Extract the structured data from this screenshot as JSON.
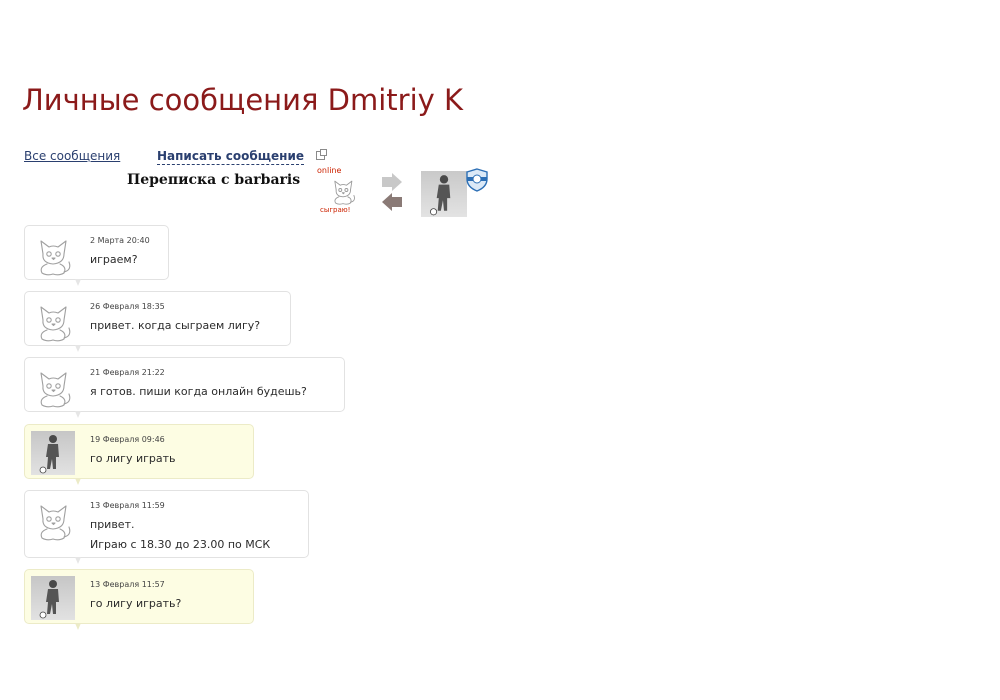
{
  "page": {
    "title": "Личные сообщения Dmitriy K"
  },
  "nav": {
    "all_messages": "Все сообщения",
    "write_message": "Написать сообщение"
  },
  "conversation": {
    "label": "Переписка с barbaris",
    "partner_status": "online",
    "partner_badge": "сыграю!"
  },
  "icons": {
    "partner_avatar": "cat-icon",
    "swap": "swap-arrows-icon",
    "my_avatar": "footballer-icon",
    "badge": "shield-icon"
  },
  "colors": {
    "title": "#8b1a1a",
    "link": "#2a3f6f",
    "my_message_bg": "#fdfde3"
  },
  "messages": [
    {
      "author": "barbaris",
      "time": "2 Марта 20:40",
      "lines": [
        "играем?"
      ]
    },
    {
      "author": "barbaris",
      "time": "26 Февраля 18:35",
      "lines": [
        "привет. когда сыграем лигу?"
      ]
    },
    {
      "author": "barbaris",
      "time": "21 Февраля 21:22",
      "lines": [
        "я готов. пиши когда онлайн будешь?"
      ]
    },
    {
      "author": "me",
      "time": "19 Февраля 09:46",
      "lines": [
        "го лигу играть"
      ]
    },
    {
      "author": "barbaris",
      "time": "13 Февраля 11:59",
      "lines": [
        "привет.",
        "Играю с 18.30 до 23.00 по МСК"
      ]
    },
    {
      "author": "me",
      "time": "13 Февраля 11:57",
      "lines": [
        "го лигу играть?"
      ]
    }
  ]
}
